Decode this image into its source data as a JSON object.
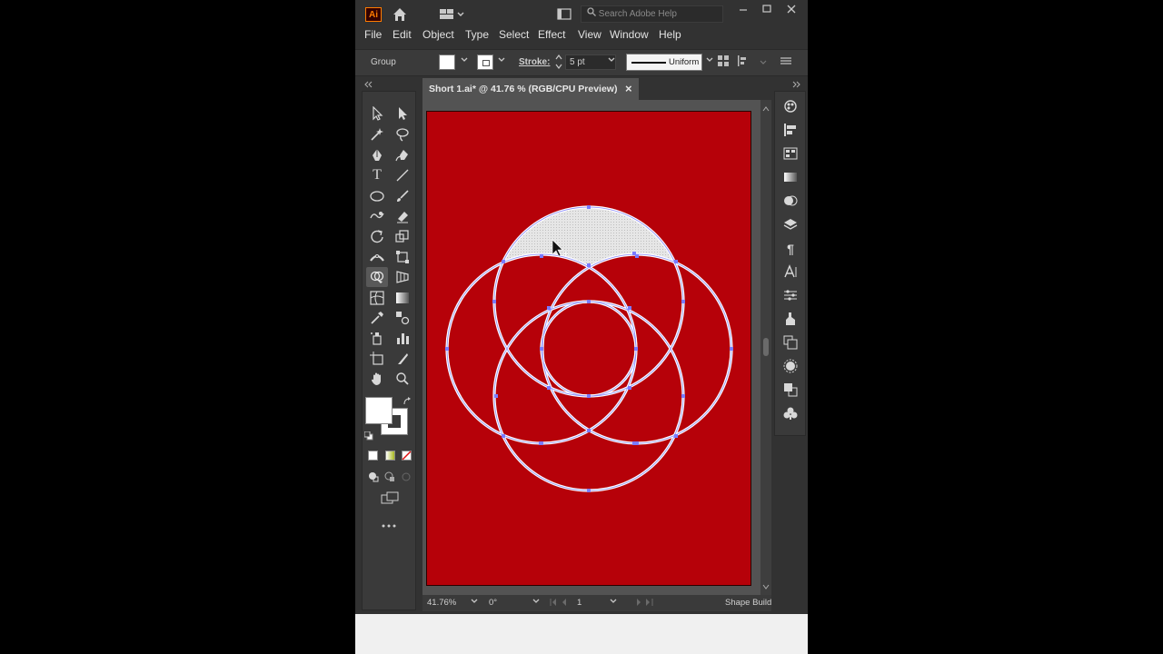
{
  "app": {
    "logo_text": "Ai",
    "search_placeholder": "Search Adobe Help"
  },
  "menu": {
    "items": [
      "File",
      "Edit",
      "Object",
      "Type",
      "Select",
      "Effect",
      "View",
      "Window",
      "Help"
    ]
  },
  "control": {
    "selection_label": "Group",
    "stroke_label": "Stroke:",
    "stroke_weight": "5 pt",
    "profile_label": "Uniform"
  },
  "document": {
    "tab_title": "Short 1.ai* @ 41.76 % (RGB/CPU Preview)",
    "close_glyph": "×"
  },
  "status": {
    "zoom": "41.76%",
    "rotation": "0°",
    "artboard_number": "1",
    "active_tool": "Shape Build"
  },
  "colors": {
    "artboard_fill": "#b60109",
    "stroke": "#ffffff",
    "anchor": "#7a7aff",
    "selected_fill": "#e6e6e6",
    "ui_dark": "#323232",
    "ui_panel": "#3a3a3a",
    "pasteboard": "#535353"
  },
  "icons": {
    "home": "home-icon",
    "workspace": "workspace-switcher-icon",
    "search": "search-icon",
    "more_tools": "more-tools-icon"
  }
}
